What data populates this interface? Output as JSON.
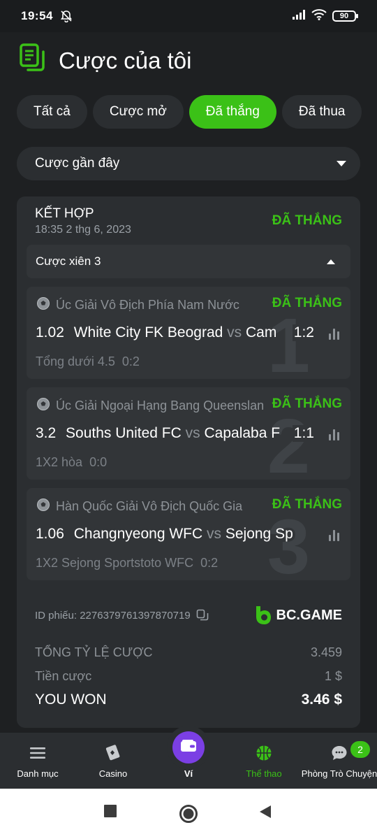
{
  "status_bar": {
    "time": "19:54",
    "battery": "90"
  },
  "header": {
    "title": "Cược của tôi"
  },
  "tabs": [
    {
      "label": "Tất cả"
    },
    {
      "label": "Cược mở"
    },
    {
      "label": "Đã thắng"
    },
    {
      "label": "Đã thua"
    }
  ],
  "filter": {
    "label": "Cược gần đây"
  },
  "bet": {
    "type": "KẾT HỢP",
    "date": "18:35 2 thg 6, 2023",
    "status": "ĐÃ THẮNG",
    "parlay_label": "Cược xiên 3",
    "legs": [
      {
        "number": "1",
        "league": "Úc Giải Vô Địch Phía Nam Nước",
        "status": "ĐÃ THẮNG",
        "odds": "1.02",
        "home": "White City FK Beograd",
        "vs": "vs",
        "away": "Cam",
        "score": "1:2",
        "pick": "Tổng dưới 4.5",
        "pick_score": "0:2"
      },
      {
        "number": "2",
        "league": "Úc Giải Ngoại Hạng Bang Queensland",
        "status": "ĐÃ THẮNG",
        "odds": "3.2",
        "home": "Souths United FC",
        "vs": "vs",
        "away": "Capalaba F",
        "score": "1:1",
        "pick": "1X2 hòa",
        "pick_score": "0:0"
      },
      {
        "number": "3",
        "league": "Hàn Quốc Giải Vô Địch Quốc Gia",
        "status": "ĐÃ THẮNG",
        "odds": "1.06",
        "home": "Changnyeong WFC",
        "vs": "vs",
        "away": "Sejong Sp",
        "score": "",
        "pick": "1X2 Sejong Sportstoto WFC",
        "pick_score": "0:2"
      }
    ],
    "ticket_label": "ID phiếu: 2276379761397870719",
    "brand": "BC.GAME",
    "total_odds_label": "TỔNG TỶ LỆ CƯỢC",
    "total_odds_value": "3.459",
    "stake_label": "Tiền cược",
    "stake_value": "1 $",
    "won_label": "YOU WON",
    "won_value": "3.46 $"
  },
  "bottom_nav": {
    "menu": "Danh mục",
    "casino": "Casino",
    "wallet": "Ví",
    "sports": "Thể thao",
    "chat": "Phòng Trò Chuyện",
    "chat_badge": "2"
  },
  "colors": {
    "accent": "#3bc117",
    "background": "#1e2022",
    "card": "#2b2e31",
    "wallet": "#7b3fe4"
  }
}
